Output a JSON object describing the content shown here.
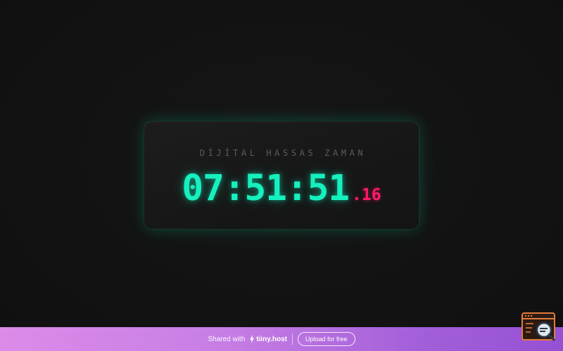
{
  "clock": {
    "title": "DİJİTAL HASSAS ZAMAN",
    "time": "07:51:51",
    "milliseconds": ".16"
  },
  "share_bar": {
    "shared_text": "Shared with",
    "brand_name": "tiiny.host",
    "upload_label": "Upload for free"
  },
  "colors": {
    "background": "#121212",
    "time_accent": "#16f0be",
    "ms_accent": "#ff1a6b",
    "bar_gradient_start": "#dc8be9",
    "bar_gradient_end": "#9550d4"
  },
  "icons": {
    "brand": "bolt-icon",
    "badge": "browser-search-icon"
  }
}
